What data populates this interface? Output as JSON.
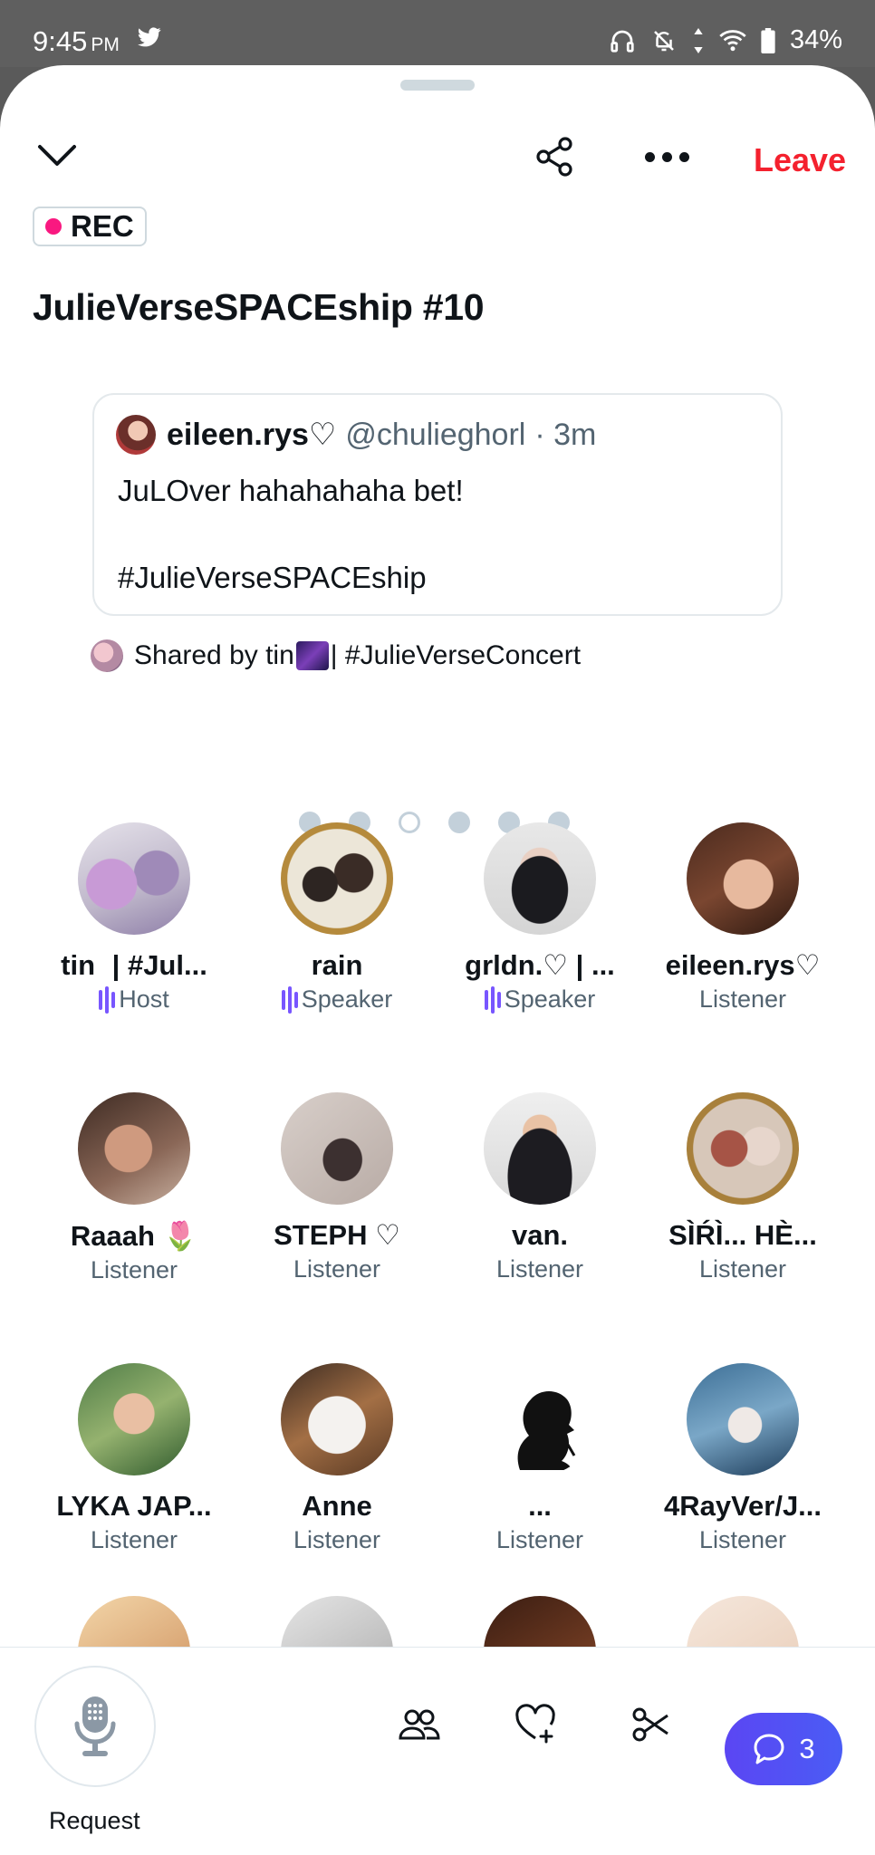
{
  "status_bar": {
    "time": "9:45",
    "ampm": "PM",
    "battery": "34%"
  },
  "header": {
    "leave_label": "Leave"
  },
  "rec_badge": "REC",
  "space_title": "JulieVerseSPACEship #10",
  "pinned_tweet": {
    "name": "eileen.rys♡",
    "handle": "@chulieghorl",
    "time": "· 3m",
    "text": "JuLOver hahahahaha bet!\n\n#JulieVerseSPACEship"
  },
  "shared_by": {
    "prefix": "Shared by tin",
    "suffix": "| #JulieVerseConcert"
  },
  "carousel": {
    "count": 6,
    "active_index": 2
  },
  "participants": [
    {
      "name": "tin   | #Jul...",
      "role": "Host",
      "speaking": true
    },
    {
      "name": "rain",
      "role": "Speaker",
      "speaking": true
    },
    {
      "name": "grldn.♡ | ...",
      "role": "Speaker",
      "speaking": true
    },
    {
      "name": "eileen.rys♡",
      "role": "Listener",
      "speaking": false
    },
    {
      "name": "Raaah 🌷",
      "role": "Listener",
      "speaking": false
    },
    {
      "name": "STEPH ♡",
      "role": "Listener",
      "speaking": false
    },
    {
      "name": "van.",
      "role": "Listener",
      "speaking": false
    },
    {
      "name": "SÌŔÌ... HÈ...",
      "role": "Listener",
      "speaking": false
    },
    {
      "name": "LYKA JAP...",
      "role": "Listener",
      "speaking": false
    },
    {
      "name": "Anne",
      "role": "Listener",
      "speaking": false
    },
    {
      "name": "...",
      "role": "Listener",
      "speaking": false
    },
    {
      "name": "4RayVer/J...",
      "role": "Listener",
      "speaking": false
    }
  ],
  "bottom_bar": {
    "request_label": "Request",
    "chat_count": "3"
  },
  "colors": {
    "leave": "#f4212e",
    "rec_dot": "#f91880",
    "speaker_bars": "#7856ff",
    "chat_pill": "#5b46f3"
  }
}
